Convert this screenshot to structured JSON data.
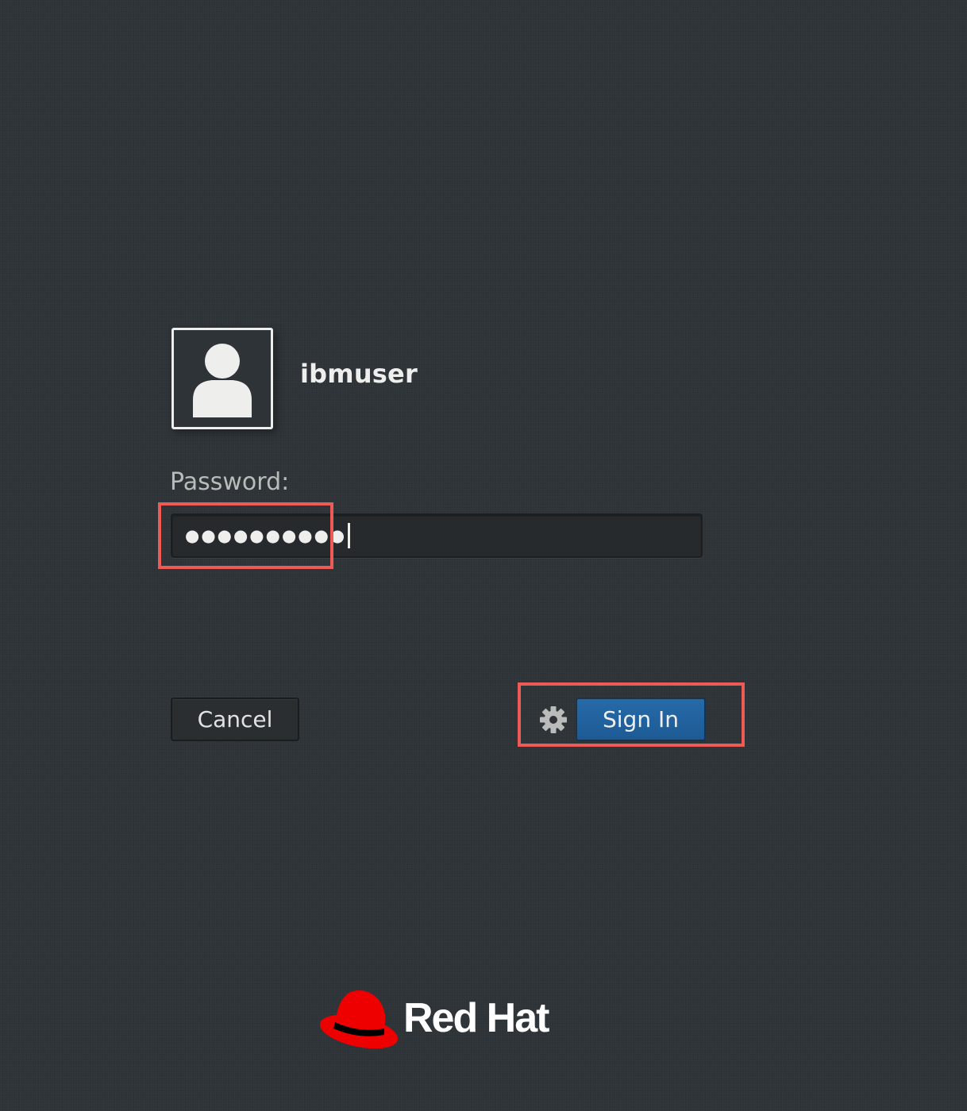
{
  "user": {
    "name": "ibmuser",
    "avatar_icon": "user-silhouette-icon"
  },
  "password": {
    "label": "Password:",
    "masked_value": "●●●●●●●●●●"
  },
  "buttons": {
    "cancel_label": "Cancel",
    "signin_label": "Sign In",
    "session_icon": "gear-icon"
  },
  "branding": {
    "logo_text": "Red Hat",
    "logo_icon": "red-hat-fedora-icon"
  },
  "colors": {
    "background": "#2d3337",
    "signin_button": "#215d9c",
    "highlight": "#ee5a56",
    "logo_red": "#ee0000"
  }
}
